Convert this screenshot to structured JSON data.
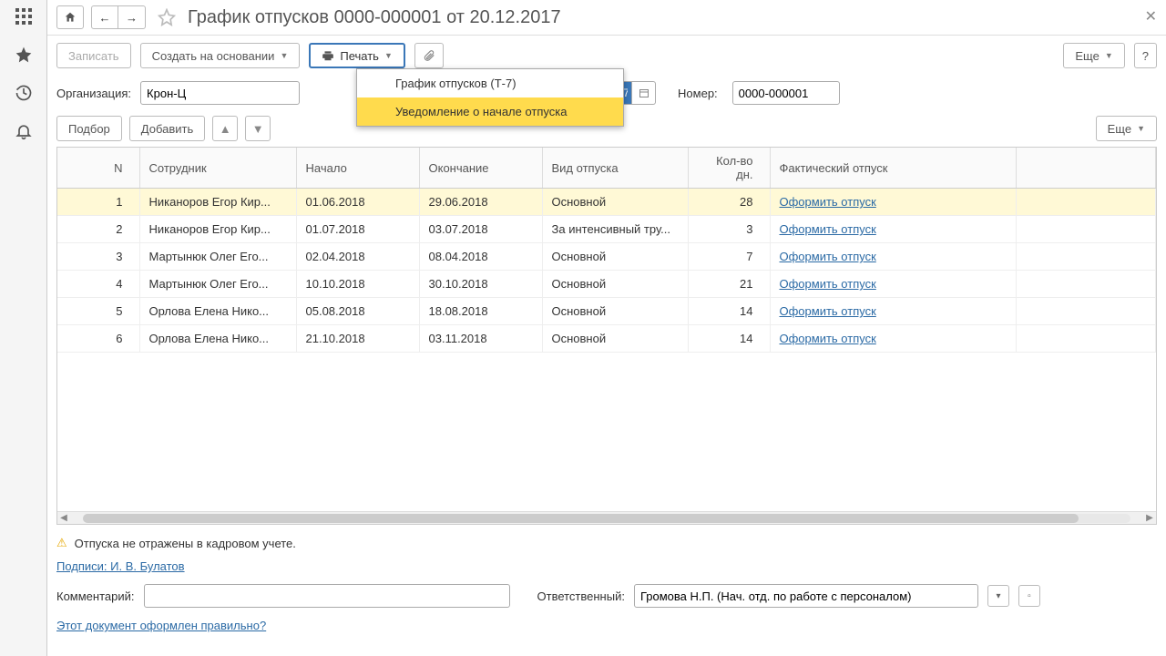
{
  "title": "График отпусков 0000-000001 от 20.12.2017",
  "cmd": {
    "write": "Записать",
    "createOn": "Создать на основании",
    "print": "Печать",
    "more": "Еще",
    "help": "?"
  },
  "printMenu": {
    "item1": "График отпусков (Т-7)",
    "item2": "Уведомление о начале отпуска"
  },
  "form": {
    "orgLabel": "Организация:",
    "orgValue": "Крон-Ц",
    "dateValue": ".12.2017",
    "numLabel": "Номер:",
    "numValue": "0000-000001"
  },
  "tblbar": {
    "pick": "Подбор",
    "add": "Добавить"
  },
  "cols": {
    "n": "N",
    "emp": "Сотрудник",
    "start": "Начало",
    "end": "Окончание",
    "type": "Вид отпуска",
    "days": "Кол-во дн.",
    "act": "Фактический отпуск"
  },
  "rows": [
    {
      "n": "1",
      "emp": "Никаноров Егор Кир...",
      "start": "01.06.2018",
      "end": "29.06.2018",
      "type": "Основной",
      "days": "28",
      "act": "Оформить отпуск"
    },
    {
      "n": "2",
      "emp": "Никаноров Егор Кир...",
      "start": "01.07.2018",
      "end": "03.07.2018",
      "type": "За интенсивный тру...",
      "days": "3",
      "act": "Оформить отпуск"
    },
    {
      "n": "3",
      "emp": "Мартынюк Олег Его...",
      "start": "02.04.2018",
      "end": "08.04.2018",
      "type": "Основной",
      "days": "7",
      "act": "Оформить отпуск"
    },
    {
      "n": "4",
      "emp": "Мартынюк Олег Его...",
      "start": "10.10.2018",
      "end": "30.10.2018",
      "type": "Основной",
      "days": "21",
      "act": "Оформить отпуск"
    },
    {
      "n": "5",
      "emp": "Орлова Елена Нико...",
      "start": "05.08.2018",
      "end": "18.08.2018",
      "type": "Основной",
      "days": "14",
      "act": "Оформить отпуск"
    },
    {
      "n": "6",
      "emp": "Орлова Елена Нико...",
      "start": "21.10.2018",
      "end": "03.11.2018",
      "type": "Основной",
      "days": "14",
      "act": "Оформить отпуск"
    }
  ],
  "footer": {
    "warn": "Отпуска не отражены в кадровом учете.",
    "sign": "Подписи: И. В. Булатов",
    "commentLabel": "Комментарий:",
    "commentValue": "",
    "respLabel": "Ответственный:",
    "respValue": "Громова Н.П. (Нач. отд. по работе с персоналом)",
    "docCheck": "Этот документ оформлен правильно?"
  }
}
